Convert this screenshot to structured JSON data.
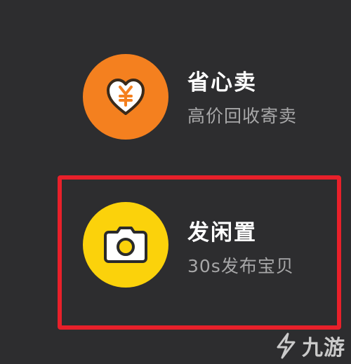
{
  "options": [
    {
      "title": "省心卖",
      "subtitle": "高价回收寄卖",
      "icon": "heart-yen-icon",
      "color": "#f4801f"
    },
    {
      "title": "发闲置",
      "subtitle": "30s发布宝贝",
      "icon": "camera-icon",
      "color": "#fbd20b"
    }
  ],
  "highlight_color": "#e8202a",
  "watermark": {
    "text": "九游"
  }
}
